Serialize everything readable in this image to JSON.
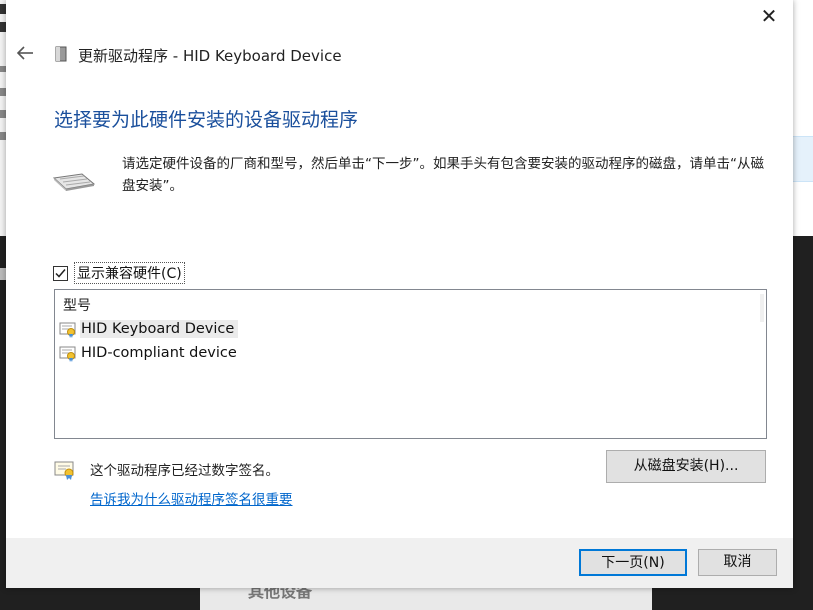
{
  "dialog": {
    "close_glyph": "✕",
    "title": "更新驱动程序 - HID Keyboard Device",
    "heading": "选择要为此硬件安装的设备驱动程序",
    "instructions": "请选定硬件设备的厂商和型号，然后单击“下一步”。如果手头有包含要安装的驱动程序的磁盘，请单击“从磁盘安装”。",
    "show_compatible_label": "显示兼容硬件(C)",
    "show_compatible_checked": true,
    "list_header": "型号",
    "models": [
      {
        "label": "HID Keyboard Device",
        "selected": true
      },
      {
        "label": "HID-compliant device",
        "selected": false
      }
    ],
    "signed_text": "这个驱动程序已经过数字签名。",
    "why_link": "告诉我为什么驱动程序签名很重要",
    "have_disk_button": "从磁盘安装(H)...",
    "next_button": "下一页(N)",
    "cancel_button": "取消"
  },
  "background": {
    "taskbar_fragment": "其他设备"
  },
  "colors": {
    "heading": "#1a4f9c",
    "link": "#0066cc",
    "default_button_border": "#0078d7",
    "backdrop": "#202020"
  },
  "icons": {
    "back": "back-arrow-icon",
    "title": "device-icon",
    "keyboard": "keyboard-icon",
    "certificate": "certificate-icon"
  }
}
